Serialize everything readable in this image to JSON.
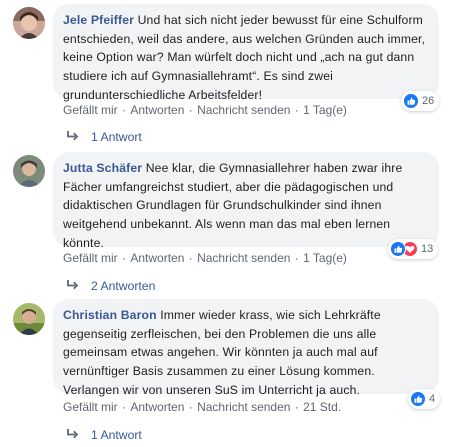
{
  "comments": [
    {
      "author": "Jele Pfeiffer",
      "text": "Und hat sich nicht jeder bewusst für eine Schulform entschieden, weil das andere, aus welchen Gründen auch immer, keine Option war? Man würfelt doch nicht und „ach na gut dann studiere ich auf Gymnasiallehramt“. Es sind zwei grundunterschiedliche Arbeitsfelder!",
      "reactions": {
        "count": "26",
        "types": [
          "like"
        ]
      },
      "actions": {
        "like": "Gefällt mir",
        "reply": "Antworten",
        "message": "Nachricht senden",
        "time": "1 Tag(e)"
      },
      "replies_label": "1 Antwort"
    },
    {
      "author": "Jutta Schäfer",
      "text": "Nee klar, die Gymnasiallehrer haben zwar ihre Fächer umfangreichst studiert, aber die pädagogischen und didaktischen Grundlagen für Grundschulkinder sind ihnen weitgehend unbekannt. Als wenn man das mal eben lernen könnte.",
      "reactions": {
        "count": "13",
        "types": [
          "like",
          "love"
        ]
      },
      "actions": {
        "like": "Gefällt mir",
        "reply": "Antworten",
        "message": "Nachricht senden",
        "time": "1 Tag(e)"
      },
      "replies_label": "2 Antworten"
    },
    {
      "author": "Christian Baron",
      "text": "Immer wieder krass, wie sich Lehrkräfte gegenseitig zerfleischen, bei den Problemen die uns alle gemeinsam etwas angehen. Wir könnten ja auch mal auf vernünftiger Basis zusammen zu einer Lösung kommen. Verlangen wir von unseren SuS im Unterricht ja auch.",
      "reactions": {
        "count": "4",
        "types": [
          "like"
        ]
      },
      "actions": {
        "like": "Gefällt mir",
        "reply": "Antworten",
        "message": "Nachricht senden",
        "time": "21 Std."
      },
      "replies_label": "1 Antwort"
    }
  ],
  "icons": {
    "reply_arrow": "reply-arrow-icon",
    "like": "like-thumb-icon",
    "love": "love-heart-icon"
  },
  "colors": {
    "author": "#385898",
    "like": "#1877f2",
    "love": "#f33e58",
    "meta": "#606770",
    "bubble": "#f2f3f5"
  }
}
